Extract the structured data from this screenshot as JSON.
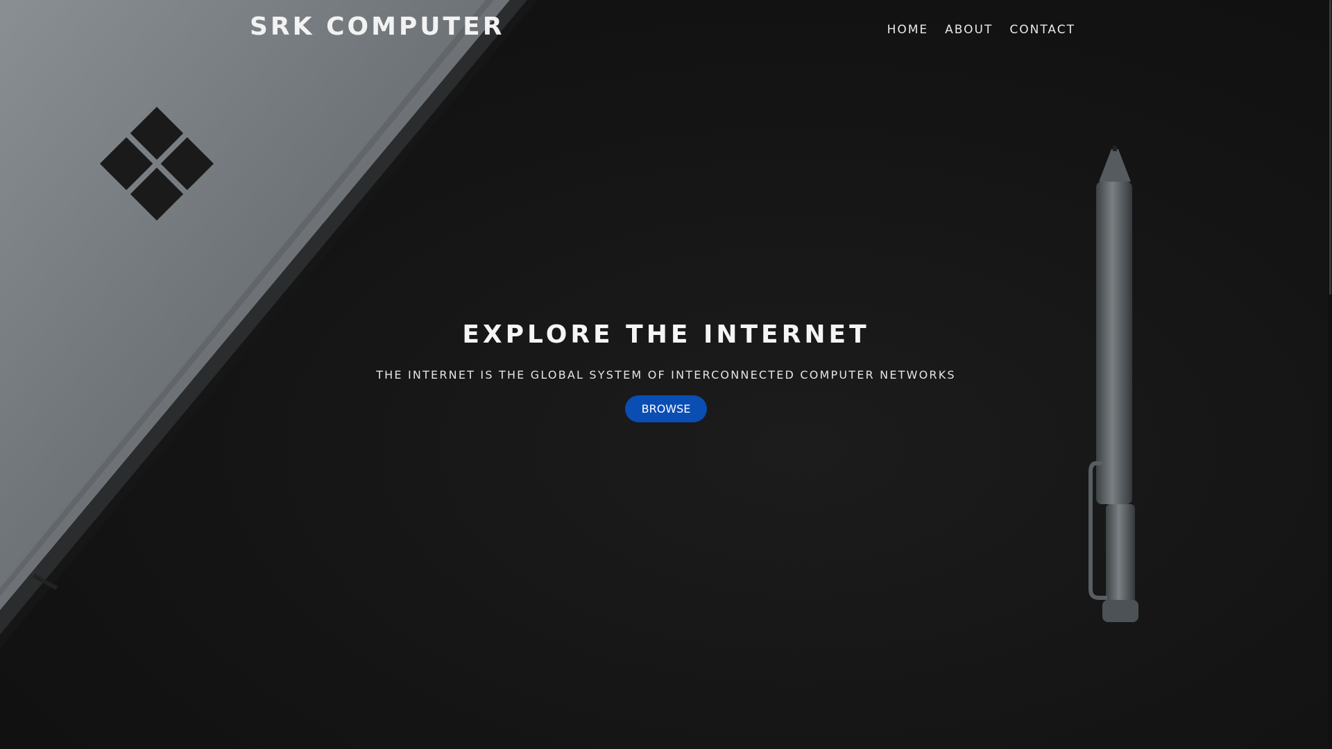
{
  "header": {
    "brand": "SRK COMPUTER",
    "nav": [
      {
        "label": "HOME"
      },
      {
        "label": "ABOUT"
      },
      {
        "label": "CONTACT"
      }
    ]
  },
  "hero": {
    "title": "EXPLORE THE INTERNET",
    "subtitle": "THE INTERNET IS THE GLOBAL SYSTEM OF INTERCONNECTED COMPUTER NETWORKS",
    "button_label": "BROWSE"
  },
  "colors": {
    "background": "#131313",
    "button": "#0a4db3",
    "text": "#f5f5f5"
  },
  "icons": {
    "logo_on_laptop": "windows-logo-icon",
    "pen": "stylus-pen-icon"
  }
}
